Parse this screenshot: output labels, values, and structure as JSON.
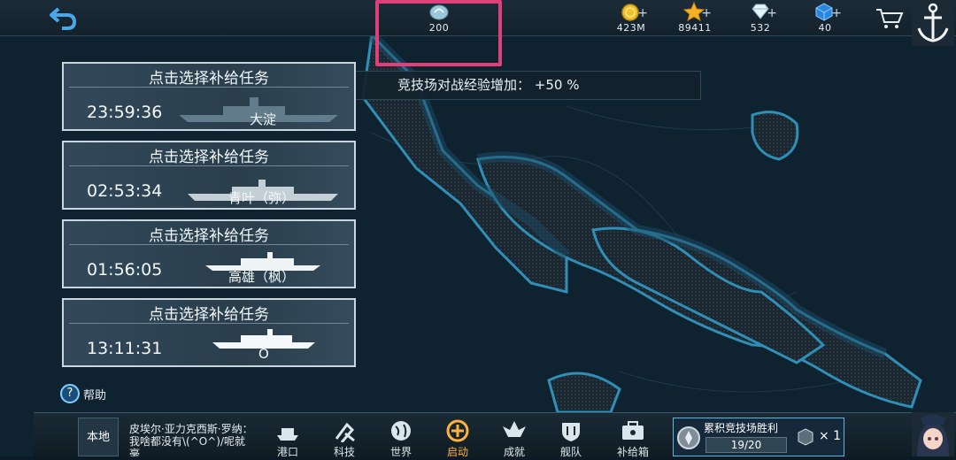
{
  "resources": {
    "fuel": {
      "value": "200",
      "icon": "fuel-gem-icon"
    },
    "gold": {
      "value": "423M",
      "icon": "gold-coin-icon"
    },
    "stars": {
      "value": "89411",
      "icon": "star-icon"
    },
    "diamonds": {
      "value": "532",
      "icon": "diamond-icon"
    },
    "cubes": {
      "value": "40",
      "icon": "blue-cube-icon"
    },
    "plus": "+"
  },
  "bonus": {
    "text": "竞技场对战经验增加：  +50 %"
  },
  "missions": [
    {
      "title": "点击选择补给任务",
      "time": "23:59:36",
      "ship": "大淀"
    },
    {
      "title": "点击选择补给任务",
      "time": "02:53:34",
      "ship": "青叶（弥）"
    },
    {
      "title": "点击选择补给任务",
      "time": "01:56:05",
      "ship": "高雄（枫）"
    },
    {
      "title": "点击选择补给任务",
      "time": "13:11:31",
      "ship": "O"
    }
  ],
  "help": {
    "icon": "?",
    "label": "帮助"
  },
  "chat": {
    "channel": "本地",
    "message": "皮埃尔·亚力克西斯·罗纳：我啥都没有\\(^O^)/呢就毫"
  },
  "nav": [
    {
      "label": "港口",
      "icon": "harbor-icon",
      "active": false
    },
    {
      "label": "科技",
      "icon": "tech-icon",
      "active": false
    },
    {
      "label": "世界",
      "icon": "globe-icon",
      "active": false
    },
    {
      "label": "启动",
      "icon": "start-icon",
      "active": true
    },
    {
      "label": "成就",
      "icon": "achievement-icon",
      "active": false
    },
    {
      "label": "舰队",
      "icon": "fleet-icon",
      "active": false
    },
    {
      "label": "补给箱",
      "icon": "supply-box-icon",
      "active": false
    }
  ],
  "arena": {
    "title": "累积竞技场胜利",
    "progress": "19/20",
    "progress_fraction": 0.95,
    "reward": "× 1"
  },
  "colors": {
    "highlight": "#e0407a",
    "accent": "#7fd0ff",
    "active_tab": "#ffb23a"
  }
}
